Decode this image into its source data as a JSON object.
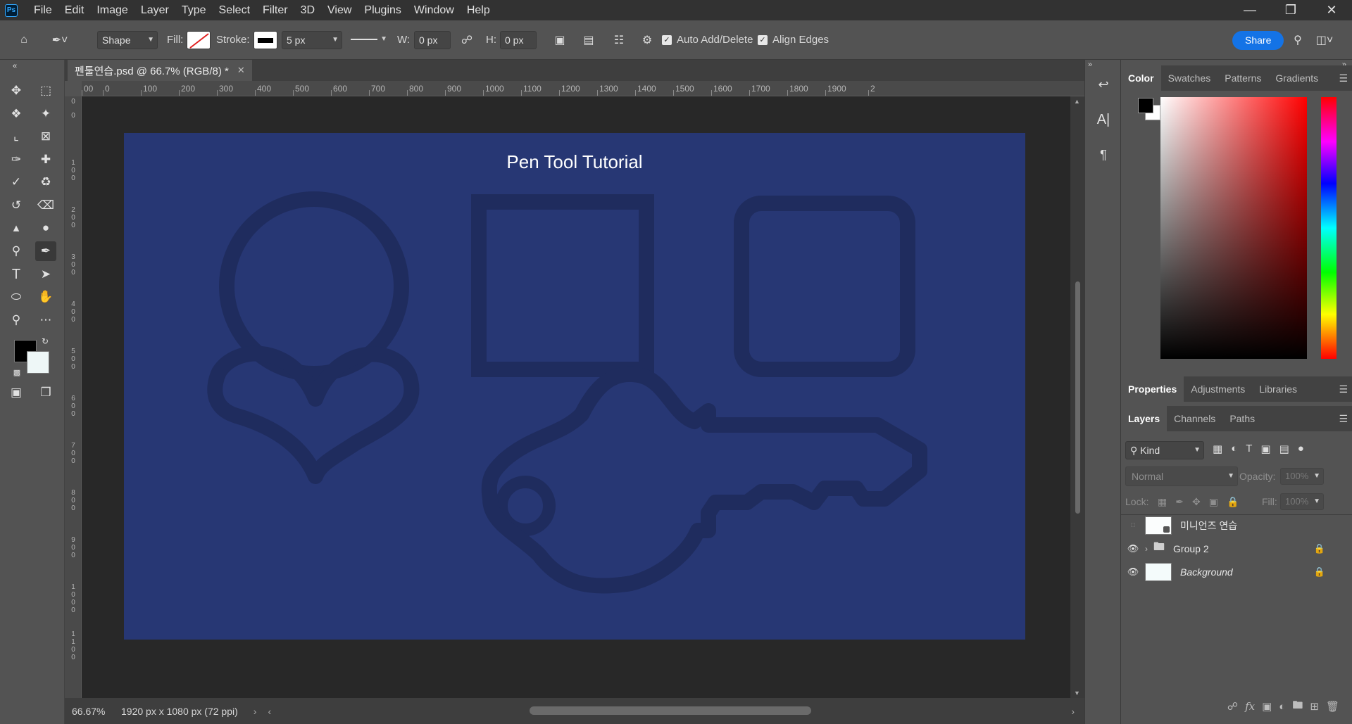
{
  "menubar": {
    "logo": "Ps",
    "items": [
      "File",
      "Edit",
      "Image",
      "Layer",
      "Type",
      "Select",
      "Filter",
      "3D",
      "View",
      "Plugins",
      "Window",
      "Help"
    ]
  },
  "options": {
    "mode": "Shape",
    "fill_label": "Fill:",
    "stroke_label": "Stroke:",
    "stroke_width": "5 px",
    "w_label": "W:",
    "w_value": "0 px",
    "h_label": "H:",
    "h_value": "0 px",
    "auto_add_delete": "Auto Add/Delete",
    "align_edges": "Align Edges",
    "share": "Share"
  },
  "document": {
    "tab_title": "펜툴연습.psd @ 66.7% (RGB/8) *",
    "canvas_title": "Pen Tool Tutorial",
    "zoom": "66.67%",
    "size_info": "1920 px x 1080 px (72 ppi)"
  },
  "ruler": {
    "top_labels": [
      "00",
      "0",
      "100",
      "200",
      "300",
      "400",
      "500",
      "600",
      "700",
      "800",
      "900",
      "1000",
      "1100",
      "1200",
      "1300",
      "1400",
      "1500",
      "1600",
      "1700",
      "1800",
      "1900",
      "2"
    ],
    "left_labels": [
      "0",
      "0",
      "100",
      "200",
      "300",
      "400",
      "500",
      "600",
      "700",
      "800",
      "900",
      "1000",
      "1100"
    ]
  },
  "panels": {
    "color_tabs": [
      "Color",
      "Swatches",
      "Patterns",
      "Gradients"
    ],
    "prop_tabs": [
      "Properties",
      "Adjustments",
      "Libraries"
    ],
    "layer_tabs": [
      "Layers",
      "Channels",
      "Paths"
    ],
    "kind": "Kind",
    "blend_mode": "Normal",
    "opacity_label": "Opacity:",
    "opacity_value": "100%",
    "lock_label": "Lock:",
    "fill_label": "Fill:",
    "fill_value": "100%",
    "layers": [
      {
        "name": "미니언즈 연습",
        "visible": false,
        "locked": false,
        "type": "smart"
      },
      {
        "name": "Group 2",
        "visible": true,
        "locked": true,
        "type": "group"
      },
      {
        "name": "Background",
        "visible": true,
        "locked": true,
        "type": "pixel"
      }
    ]
  },
  "colors": {
    "canvas_bg": "#273774",
    "shape_stroke": "#1f2c5e",
    "accent": "#1473e6",
    "foreground": "#000000",
    "background": "#eef7f7"
  }
}
